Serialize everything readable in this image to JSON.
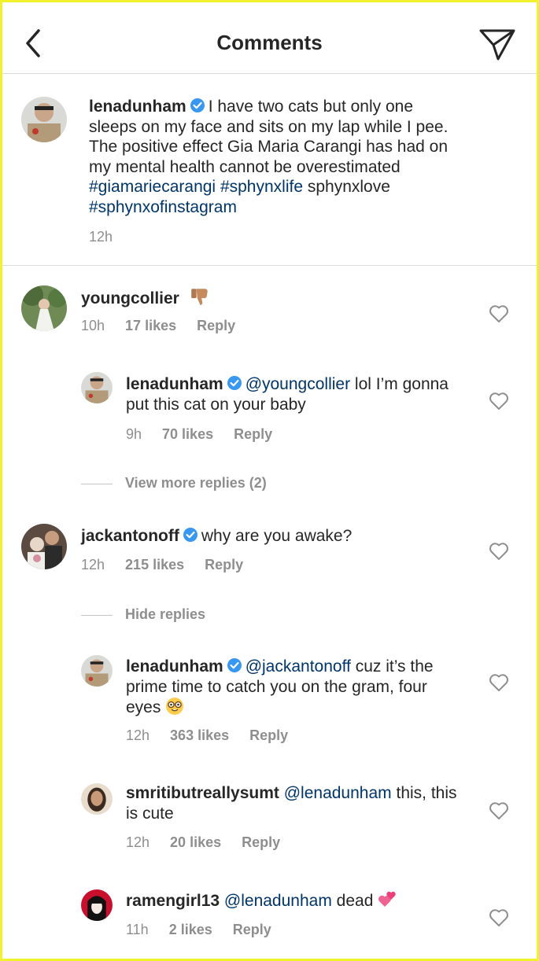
{
  "header": {
    "title": "Comments"
  },
  "caption": {
    "username": "lenadunham",
    "text": "I have two cats but only one sleeps on my face and sits on my lap while I pee. The positive effect Gia Maria Carangi has had on my mental health cannot be overestimated",
    "hashtag1": "#giamariecarangi",
    "hashtag2": "#sphynxlife",
    "plain": "sphynxlove",
    "hashtag3": "#sphynxofinstagram",
    "time": "12h"
  },
  "comments": [
    {
      "username": "youngcollier",
      "text": "",
      "time": "10h",
      "likes": "17 likes",
      "reply": "Reply"
    },
    {
      "username": "lenadunham",
      "mention": "@youngcollier",
      "text": "lol I’m gonna put this cat on your baby",
      "time": "9h",
      "likes": "70 likes",
      "reply": "Reply"
    },
    {
      "username": "jackantonoff",
      "text": "why are you awake?",
      "time": "12h",
      "likes": "215 likes",
      "reply": "Reply"
    },
    {
      "username": "lenadunham",
      "mention": "@jackantonoff",
      "text": "cuz it’s the prime time to catch you on the gram, four eyes",
      "time": "12h",
      "likes": "363 likes",
      "reply": "Reply"
    },
    {
      "username": "smritibutreallysumt",
      "mention": "@lenadunham",
      "text": "this, this is cute",
      "time": "12h",
      "likes": "20 likes",
      "reply": "Reply"
    },
    {
      "username": "ramengirl13",
      "mention": "@lenadunham",
      "text": "dead",
      "time": "11h",
      "likes": "2 likes",
      "reply": "Reply"
    }
  ],
  "toggles": {
    "view_more": "View more replies (2)",
    "hide": "Hide replies"
  },
  "icons": {
    "back": "chevron-left-icon",
    "send": "paper-plane-icon",
    "verified": "verified-badge-icon",
    "heart": "heart-outline-icon",
    "thumbs_down": "thumbs-down-emoji",
    "nerd": "nerd-face-emoji",
    "hearts": "two-hearts-emoji"
  },
  "colors": {
    "link": "#003569",
    "verified": "#3897f0",
    "meta": "#8e8e8e",
    "text": "#262626",
    "border": "#f2f22c"
  }
}
